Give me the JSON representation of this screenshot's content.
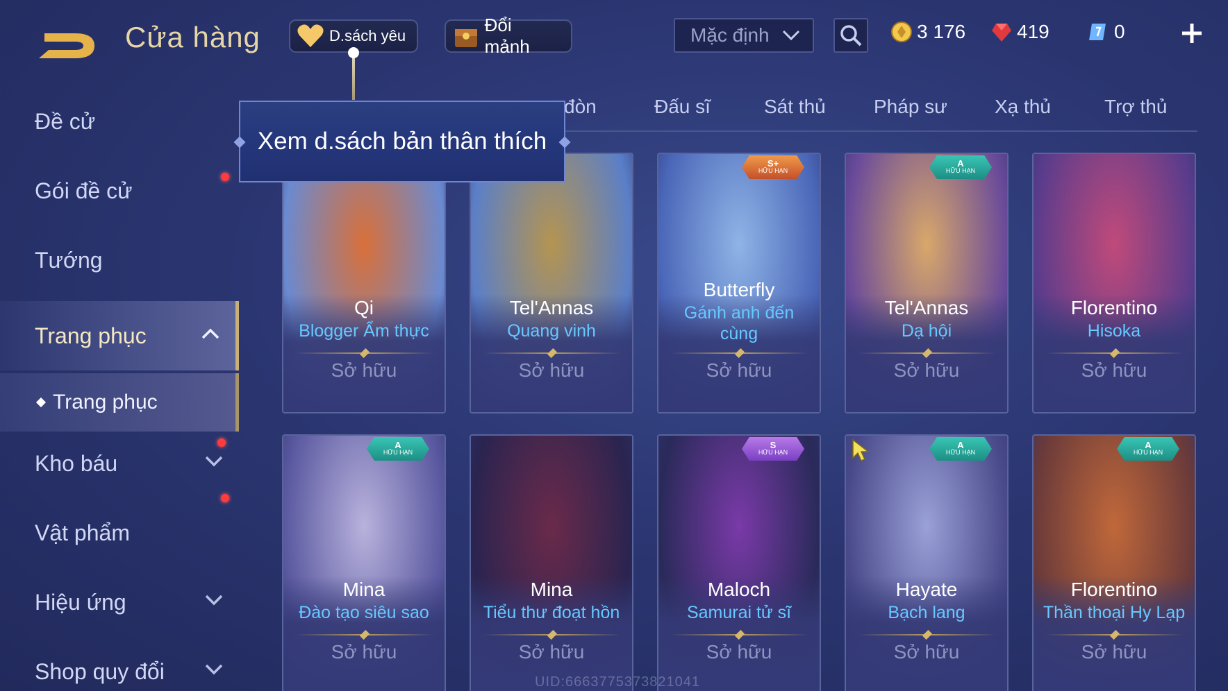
{
  "header": {
    "title": "Cửa hàng",
    "favorites_label": "D.sách yêu",
    "shard_exchange_label": "Đổi mảnh",
    "sort_value": "Mặc định"
  },
  "currencies": [
    {
      "name": "gold",
      "value": "3 176",
      "color": "#f2c94c"
    },
    {
      "name": "ruby",
      "value": "419",
      "color": "#e0393e"
    },
    {
      "name": "voucher",
      "value": "0",
      "color": "#6fb5ff"
    }
  ],
  "sidebar": {
    "items": [
      {
        "label": "Đề cử"
      },
      {
        "label": "Gói đề cử"
      },
      {
        "label": "Tướng"
      },
      {
        "label": "Trang phục"
      },
      {
        "label": "Trang phục"
      },
      {
        "label": "Kho báu"
      },
      {
        "label": "Vật phẩm"
      },
      {
        "label": "Hiệu ứng"
      },
      {
        "label": "Shop quy đổi"
      }
    ]
  },
  "tabs": [
    {
      "label": "đòn"
    },
    {
      "label": "Đấu sĩ"
    },
    {
      "label": "Sát thủ"
    },
    {
      "label": "Pháp sư"
    },
    {
      "label": "Xạ thủ"
    },
    {
      "label": "Trợ thủ"
    }
  ],
  "tooltip": {
    "text": "Xem d.sách bản thân thích"
  },
  "cards": [
    {
      "hero": "Qi",
      "skin": "Blogger Ẩm thực",
      "status": "Sở hữu",
      "colors": [
        "#d9703a",
        "#6a8ad0"
      ]
    },
    {
      "hero": "Tel'Annas",
      "skin": "Quang vinh",
      "status": "Sở hữu",
      "colors": [
        "#b59450",
        "#5a7fc8"
      ]
    },
    {
      "hero": "Butterfly",
      "skin": "Gánh anh đến cùng",
      "status": "Sở hữu",
      "rank": "S+",
      "rank_text": "HỮU HẠN",
      "colors": [
        "#8fb4e6",
        "#4a66b8"
      ]
    },
    {
      "hero": "Tel'Annas",
      "skin": "Dạ hội",
      "status": "Sở hữu",
      "rank": "A",
      "rank_text": "HỮU HẠN",
      "colors": [
        "#d8a86a",
        "#6a4a9a"
      ]
    },
    {
      "hero": "Florentino",
      "skin": "Hisoka",
      "status": "Sở hữu",
      "colors": [
        "#c04a7a",
        "#5a3c8c"
      ]
    },
    {
      "hero": "Mina",
      "skin": "Đào tạo siêu sao",
      "status": "Sở hữu",
      "rank": "A",
      "rank_text": "HỮU HẠN",
      "colors": [
        "#b8b2dc",
        "#5a58a0"
      ]
    },
    {
      "hero": "Mina",
      "skin": "Tiểu thư đoạt hồn",
      "status": "Sở hữu",
      "colors": [
        "#6a2a4a",
        "#2a2450"
      ]
    },
    {
      "hero": "Maloch",
      "skin": "Samurai tử sĩ",
      "status": "Sở hữu",
      "rank": "S",
      "rank_text": "HỮU HẠN",
      "colors": [
        "#7a3aa8",
        "#2a2a5a"
      ]
    },
    {
      "hero": "Hayate",
      "skin": "Bạch lang",
      "status": "Sở hữu",
      "rank": "A",
      "rank_text": "HỮU HẠN",
      "colors": [
        "#9aa0d8",
        "#4a4a8a"
      ]
    },
    {
      "hero": "Florentino",
      "skin": "Thần thoại Hy Lạp",
      "status": "Sở hữu",
      "rank": "A",
      "rank_text": "HỮU HẠN",
      "colors": [
        "#c0683a",
        "#6a3a3a"
      ]
    }
  ],
  "watermark": "UID:6663775373821041"
}
